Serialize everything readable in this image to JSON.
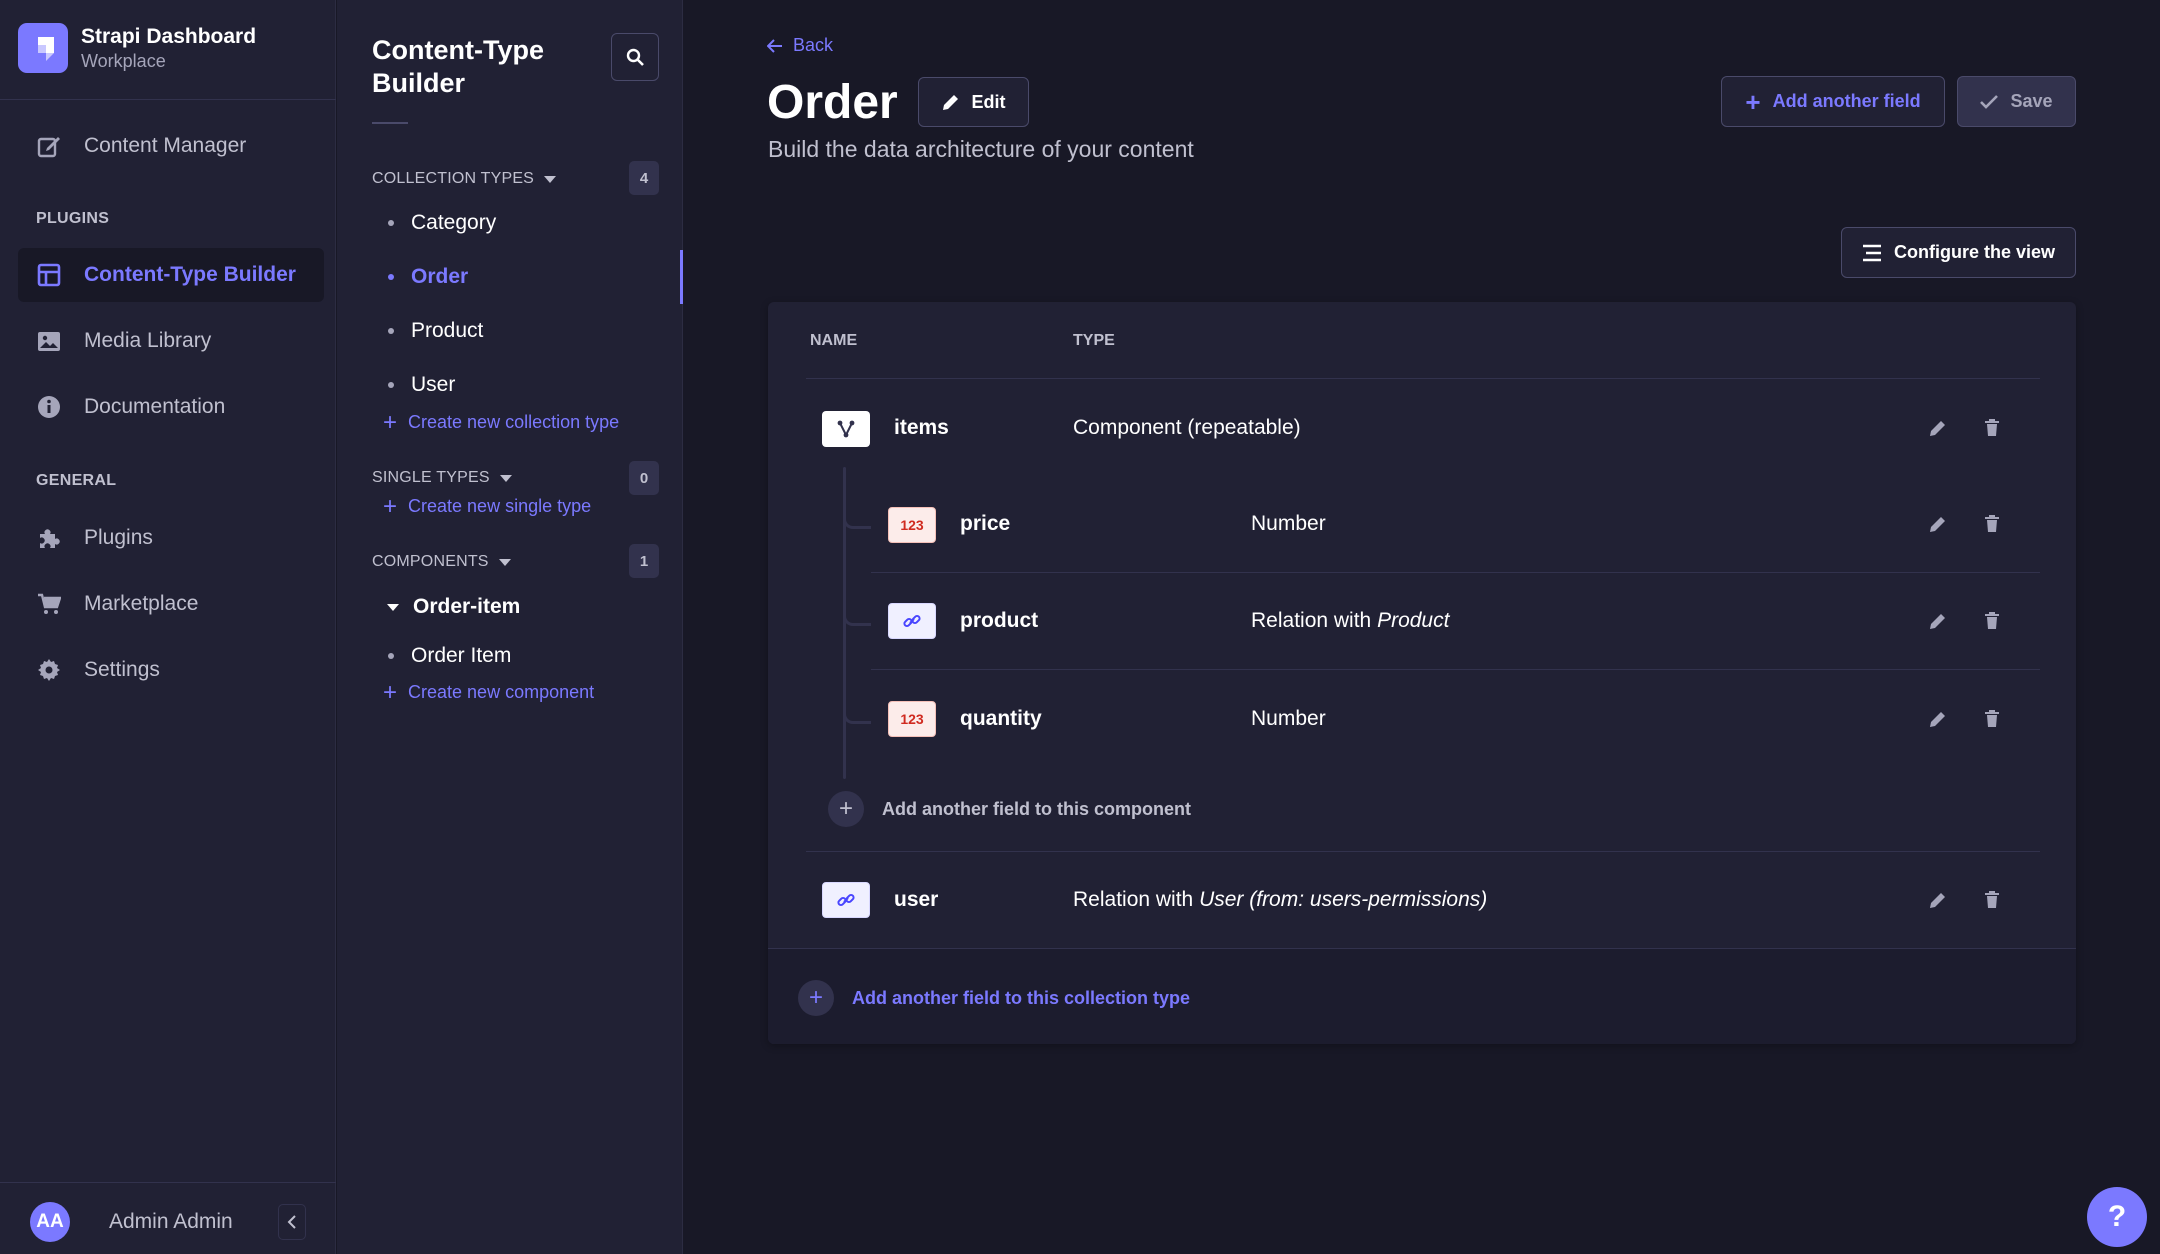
{
  "brand": {
    "title": "Strapi Dashboard",
    "subtitle": "Workplace"
  },
  "mainnav": {
    "content_manager": "Content Manager",
    "plugins_section": "PLUGINS",
    "content_type_builder": "Content-Type Builder",
    "media_library": "Media Library",
    "documentation": "Documentation",
    "general_section": "GENERAL",
    "plugins": "Plugins",
    "marketplace": "Marketplace",
    "settings": "Settings"
  },
  "user": {
    "initials": "AA",
    "name": "Admin Admin"
  },
  "subnav": {
    "title": "Content-Type Builder",
    "collection_types": {
      "label": "COLLECTION TYPES",
      "count": "4",
      "items": [
        "Category",
        "Order",
        "Product",
        "User"
      ],
      "create": "Create new collection type"
    },
    "single_types": {
      "label": "SINGLE TYPES",
      "count": "0",
      "create": "Create new single type"
    },
    "components": {
      "label": "COMPONENTS",
      "count": "1",
      "category": "Order-item",
      "items": [
        "Order Item"
      ],
      "create": "Create new component"
    }
  },
  "header": {
    "back": "Back",
    "title": "Order",
    "edit": "Edit",
    "subtitle": "Build the data architecture of your content",
    "add_field": "Add another field",
    "save": "Save",
    "configure": "Configure the view"
  },
  "table": {
    "col_name": "NAME",
    "col_type": "TYPE",
    "rows": [
      {
        "name": "items",
        "type": "Component (repeatable)",
        "type_em": ""
      },
      {
        "name": "price",
        "type": "Number",
        "type_em": "",
        "icon_text": "123"
      },
      {
        "name": "product",
        "type": "Relation with ",
        "type_em": "Product"
      },
      {
        "name": "quantity",
        "type": "Number",
        "type_em": "",
        "icon_text": "123"
      },
      {
        "name": "user",
        "type": "Relation with ",
        "type_em": "User (from: users-permissions)"
      }
    ],
    "add_component_field": "Add another field to this component",
    "add_collection_field": "Add another field to this collection type"
  },
  "colors": {
    "accent": "#7b79ff",
    "background": "#181826",
    "panel": "#212134"
  }
}
